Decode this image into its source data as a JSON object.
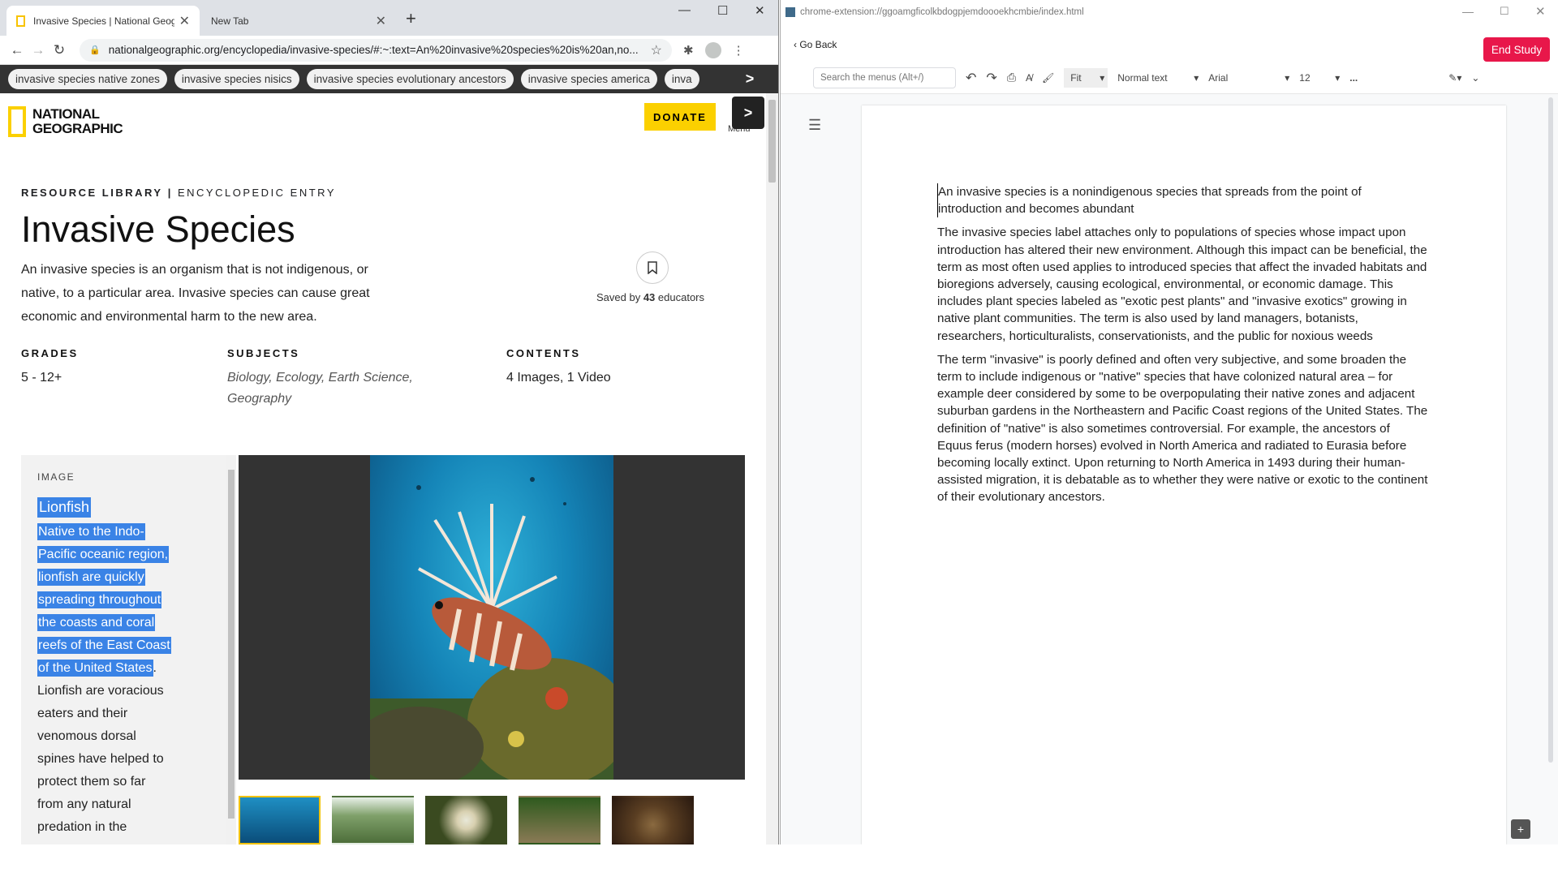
{
  "left_window": {
    "tabs": [
      {
        "title": "Invasive Species | National Geographic"
      },
      {
        "title": "New Tab"
      }
    ],
    "url": "nationalgeographic.org/encyclopedia/invasive-species/#:~:text=An%20invasive%20species%20is%20an,no...",
    "chips": [
      "invasive species native zones",
      "invasive species nisics",
      "invasive species evolutionary ancestors",
      "invasive species america",
      "inva"
    ],
    "chip_next": ">",
    "logo_text": "NATIONAL GEOGRAPHIC",
    "donate": "DONATE",
    "menu": "Menu",
    "menu_next": ">",
    "breadcrumb_a": "RESOURCE LIBRARY",
    "breadcrumb_sep": "|",
    "breadcrumb_b": "ENCYCLOPEDIC ENTRY",
    "title": "Invasive Species",
    "lead": "An invasive species is an organism that is not indigenous, or native, to a particular area. Invasive species can cause great economic and environmental harm to the new area.",
    "saved_prefix": "Saved by",
    "saved_count": "43",
    "saved_suffix": "educators",
    "grades_label": "GRADES",
    "grades_value": "5 - 12+",
    "subjects_label": "SUBJECTS",
    "subjects_value": "Biology, Ecology, Earth Science, Geography",
    "contents_label": "CONTENTS",
    "contents_value": "4 Images, 1 Video",
    "image_label": "IMAGE",
    "caption_title": "Lionfish",
    "caption_selected_lines": [
      "Native to the Indo-",
      "Pacific oceanic region,",
      "lionfish are quickly",
      "spreading throughout",
      "the coasts and coral",
      "reefs of the East Coast",
      "of the United States"
    ],
    "caption_rest_lines": [
      "Lionfish are voracious",
      "eaters and their",
      "venomous dorsal",
      "spines have helped to",
      "protect them so far",
      "from any natural",
      "predation in the"
    ]
  },
  "right_window": {
    "title_url": "chrome-extension://ggoamgficolkbdogpjemdoooekhcmbie/index.html",
    "go_back": "Go Back",
    "end_study": "End Study",
    "search_placeholder": "Search the menus (Alt+/)",
    "zoom": "Fit",
    "style": "Normal text",
    "font": "Arial",
    "size": "12",
    "more": "...",
    "paragraphs": [
      "An invasive species is a nonindigenous species that spreads from the point of introduction and becomes abundant",
      "The invasive species label attaches only to populations of species whose impact upon introduction has altered their new environment. Although this impact can be beneficial, the term as most often used applies to introduced species that affect the invaded habitats and bioregions adversely, causing ecological, environmental, or economic damage. This includes plant species labeled as \"exotic pest plants\" and \"invasive exotics\" growing in native plant communities. The term is also used by land managers, botanists, researchers, horticulturalists, conservationists, and the public for noxious weeds",
      "The term \"invasive\" is poorly defined and often very subjective, and some broaden the term to include indigenous or \"native\" species that have colonized natural area – for example deer considered by some to be overpopulating their native zones and adjacent suburban gardens in the Northeastern and Pacific Coast regions of the United States. The definition of \"native\" is also sometimes controversial. For example, the ancestors of Equus ferus (modern horses) evolved in North America and radiated to Eurasia before becoming locally extinct. Upon returning to North America in 1493 during their human-assisted migration, it is debatable as to whether they were native or exotic to the continent of their evolutionary ancestors."
    ]
  }
}
